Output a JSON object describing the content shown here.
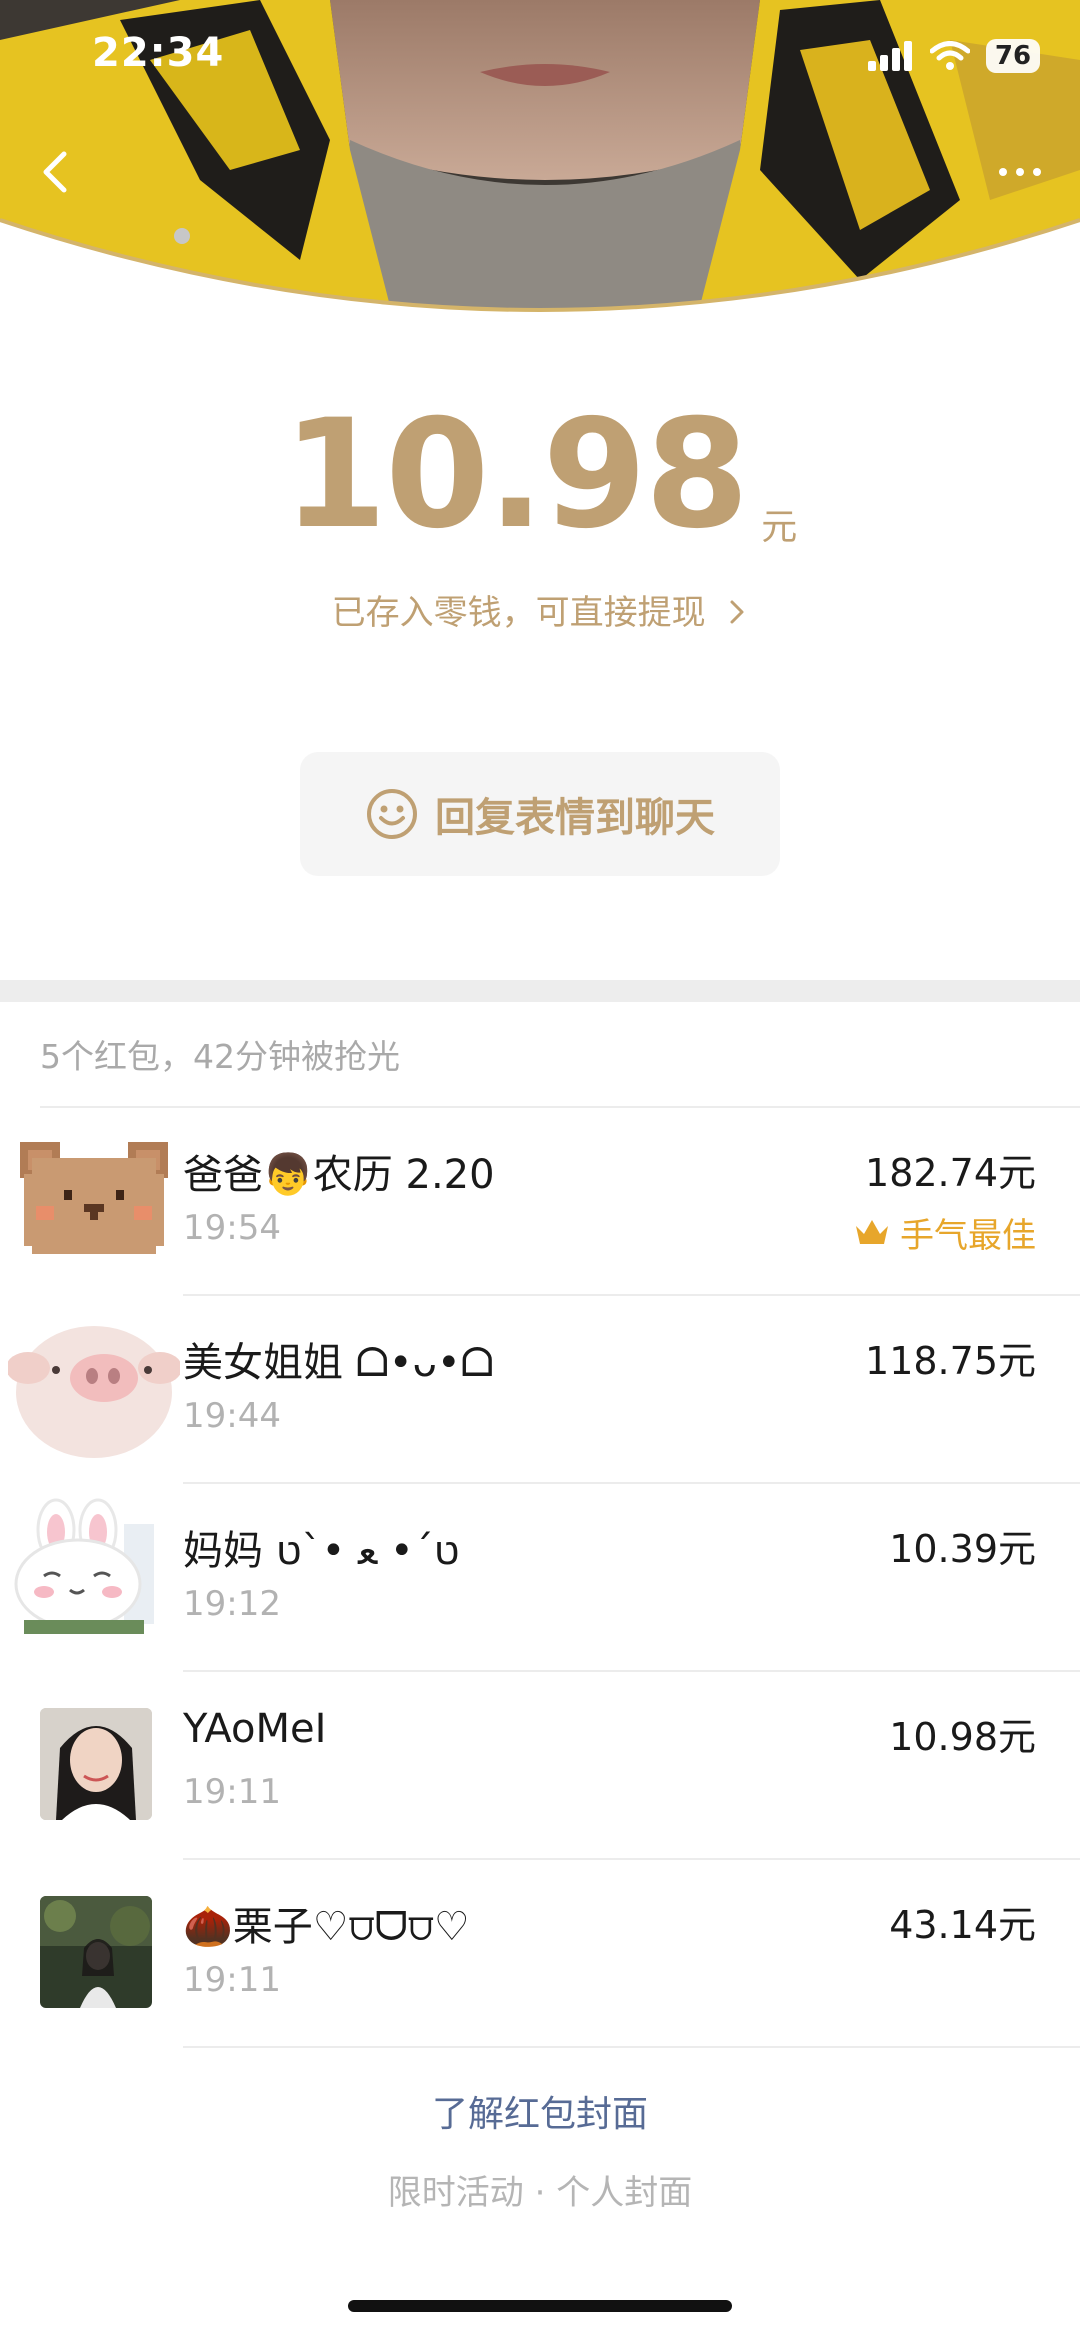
{
  "status_bar": {
    "time": "22:34",
    "battery": "76",
    "signal_icon": "cellular-signal-icon",
    "wifi_icon": "wifi-icon"
  },
  "nav": {
    "back_icon": "chevron-left-icon",
    "more_icon": "more-dots-icon"
  },
  "packet": {
    "amount": "10.98",
    "unit": "元",
    "saved_note": "已存入零钱，可直接提现",
    "reply_label": "回复表情到聊天",
    "reply_icon": "smiley-icon"
  },
  "summary": "5个红包，42分钟被抢光",
  "records": [
    {
      "name": "爸爸👦农历 2.20",
      "time": "19:54",
      "amount": "182.74元",
      "best_label": "手气最佳",
      "avatar": "pixel-bear-avatar"
    },
    {
      "name": "美女姐姐 ᗝ•ᴗ•ᗝ",
      "time": "19:44",
      "amount": "118.75元",
      "avatar": "piglet-avatar"
    },
    {
      "name": "妈妈 ט´• ﻌ •`ט",
      "time": "19:12",
      "amount": "10.39元",
      "avatar": "bunny-avatar"
    },
    {
      "name": "YAoMeI",
      "time": "19:11",
      "amount": "10.98元",
      "avatar": "girl-photo-avatar"
    },
    {
      "name": "🌰栗子♡⩌ᗜ⩌♡",
      "time": "19:11",
      "amount": "43.14元",
      "avatar": "forest-photo-avatar"
    }
  ],
  "footer": {
    "link": "了解红包封面",
    "sub": "限时活动 · 个人封面"
  },
  "colors": {
    "gold": "#bfa073",
    "best": "#e7a62b",
    "link": "#576b95"
  }
}
